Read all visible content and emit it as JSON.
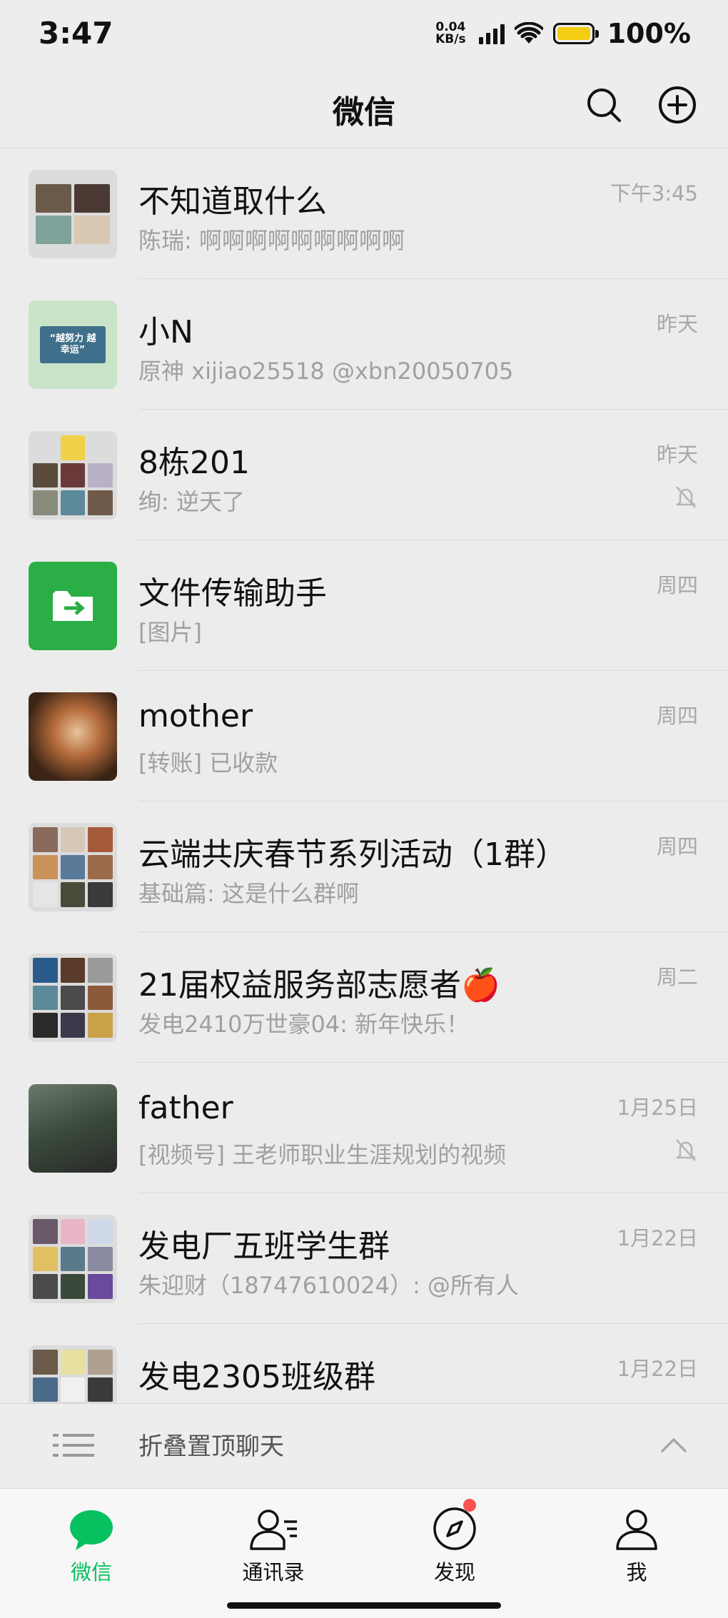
{
  "status_bar": {
    "time": "3:47",
    "net_speed": "0.04",
    "net_unit": "KB/s",
    "battery": "100%"
  },
  "header": {
    "title": "微信"
  },
  "chats": [
    {
      "name": "不知道取什么",
      "preview": "陈瑞: 啊啊啊啊啊啊啊啊啊",
      "time": "下午3:45"
    },
    {
      "name": "小N",
      "preview": "原神 xijiao25518 @xbn20050705",
      "time": "昨天",
      "avatar_text": "“越努力 越幸运”"
    },
    {
      "name": "8栋201",
      "preview": "绚: 逆天了",
      "time": "昨天",
      "muted": true
    },
    {
      "name": "文件传输助手",
      "preview": "[图片]",
      "time": "周四"
    },
    {
      "name": "mother",
      "preview": "[转账] 已收款",
      "time": "周四"
    },
    {
      "name": "云端共庆春节系列活动（1群）",
      "preview": "基础篇: 这是什么群啊",
      "time": "周四"
    },
    {
      "name": "21届权益服务部志愿者🍎",
      "preview": "发电2410万世豪04: 新年快乐！",
      "time": "周二"
    },
    {
      "name": "father",
      "preview": "[视频号] 王老师职业生涯规划的视频",
      "time": "1月25日",
      "muted": true
    },
    {
      "name": "发电厂五班学生群",
      "preview": "朱迎财（18747610024）: @所有人",
      "time": "1月22日"
    },
    {
      "name": "发电2305班级群",
      "preview": "",
      "time": "1月22日"
    }
  ],
  "fold_bar": {
    "label": "折叠置顶聊天"
  },
  "tabs": [
    {
      "label": "微信",
      "icon": "chat-bubble-icon",
      "active": true
    },
    {
      "label": "通讯录",
      "icon": "contacts-icon"
    },
    {
      "label": "发现",
      "icon": "compass-icon",
      "badge_dot": true
    },
    {
      "label": "我",
      "icon": "person-icon"
    }
  ],
  "colors": {
    "accent": "#07c160",
    "background": "#ededed",
    "file_helper": "#2aae45",
    "badge": "#fa5151",
    "battery": "#f4cc12"
  }
}
